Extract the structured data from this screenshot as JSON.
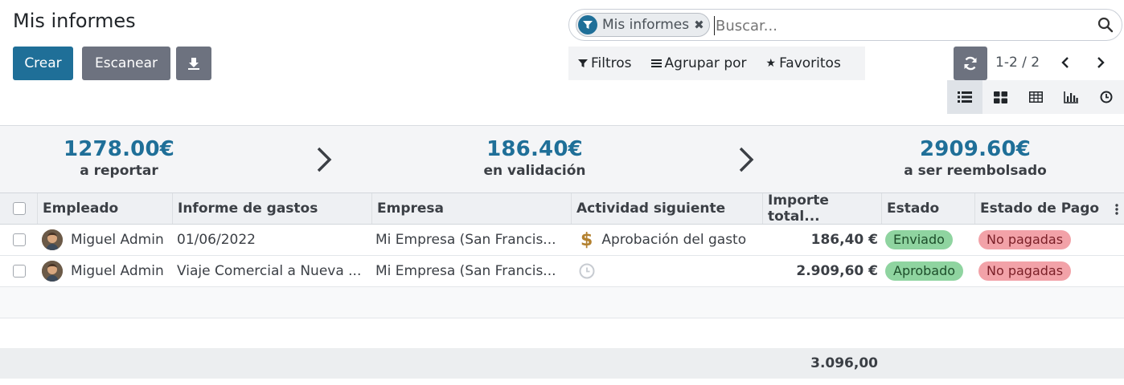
{
  "page": {
    "title": "Mis informes"
  },
  "buttons": {
    "create": "Crear",
    "scan": "Escanear"
  },
  "search": {
    "facet_label": "Mis informes",
    "placeholder": "Buscar..."
  },
  "search_panel": {
    "filters": "Filtros",
    "group_by": "Agrupar por",
    "favorites": "Favoritos"
  },
  "pager": {
    "value": "1-2 / 2"
  },
  "views": {
    "active": "list",
    "available": [
      "list",
      "kanban",
      "pivot",
      "graph",
      "activity"
    ]
  },
  "dashboard": {
    "stats": [
      {
        "amount": "1278.00€",
        "label": "a reportar"
      },
      {
        "amount": "186.40€",
        "label": "en validación"
      },
      {
        "amount": "2909.60€",
        "label": "a ser reembolsado"
      }
    ]
  },
  "table": {
    "headers": {
      "employee": "Empleado",
      "report": "Informe de gastos",
      "company": "Empresa",
      "activity": "Actividad siguiente",
      "total": "Importe total...",
      "state": "Estado",
      "payment_state": "Estado de Pago"
    },
    "rows": [
      {
        "employee": "Miguel Admin",
        "report": "01/06/2022",
        "company": "Mi Empresa (San Francis...",
        "activity_icon": "dollar-icon",
        "activity": "Aprobación del gasto",
        "total": "186,40 €",
        "state": "Enviado",
        "payment_state": "No pagadas"
      },
      {
        "employee": "Miguel Admin",
        "report": "Viaje Comercial a Nueva ...",
        "company": "Mi Empresa (San Francis...",
        "activity_icon": "clock-icon",
        "activity": "",
        "total": "2.909,60 €",
        "state": "Aprobado",
        "payment_state": "No pagadas"
      }
    ],
    "footer_total": "3.096,00"
  },
  "colors": {
    "primary": "#1f6f98",
    "secondary": "#6d727f",
    "badge_success": "#8fd4a0",
    "badge_danger": "#f2a2a8"
  }
}
